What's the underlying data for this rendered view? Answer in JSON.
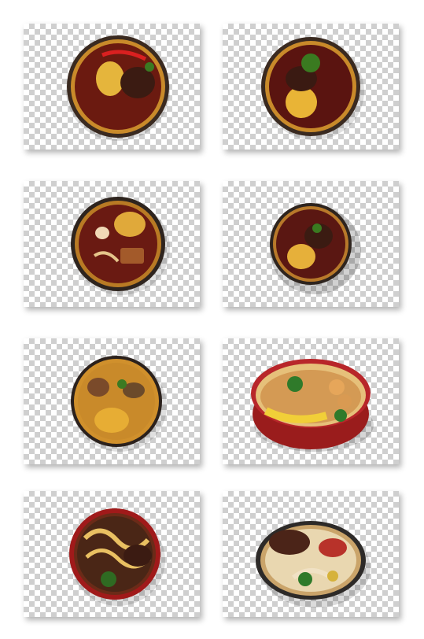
{
  "gallery": {
    "items": [
      {
        "name": "noodle-bowl-1",
        "bowl_rim": "#3a2a20",
        "bowl_inner": "#c98a2a",
        "broth": "#6b1a10",
        "topping": "#e5b53c"
      },
      {
        "name": "noodle-bowl-2",
        "bowl_rim": "#3a2a20",
        "bowl_inner": "#c98a2a",
        "broth": "#5a1410",
        "topping": "#e9b436"
      },
      {
        "name": "noodle-bowl-3",
        "bowl_rim": "#2e241e",
        "bowl_inner": "#b97a24",
        "broth": "#6a1a12",
        "topping": "#e0a93a"
      },
      {
        "name": "noodle-bowl-4",
        "bowl_rim": "#2e241e",
        "bowl_inner": "#b8792a",
        "broth": "#5a1712",
        "topping": "#e6b03a"
      },
      {
        "name": "noodle-bowl-5",
        "bowl_rim": "#2b211c",
        "bowl_inner": "#d0902c",
        "broth": "#c98a2a",
        "topping": "#e7ad34"
      },
      {
        "name": "noodle-bowl-6",
        "bowl_rim": "#b8262a",
        "bowl_inner": "#e6c07a",
        "broth": "#d49a54",
        "topping": "#f1cf38"
      },
      {
        "name": "noodle-bowl-7",
        "bowl_rim": "#a01a1a",
        "bowl_inner": "#6b2b18",
        "broth": "#4a2616",
        "topping": "#e9c062"
      },
      {
        "name": "noodle-bowl-8",
        "bowl_rim": "#2d2a28",
        "bowl_inner": "#caa46a",
        "broth": "#e9d7b0",
        "topping": "#b8322a"
      }
    ]
  }
}
